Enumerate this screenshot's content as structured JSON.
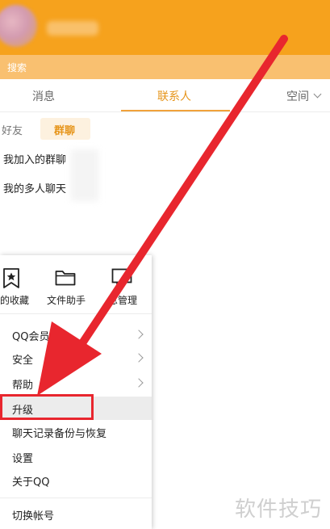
{
  "search": {
    "placeholder": "搜索"
  },
  "tabs": [
    {
      "label": "消息"
    },
    {
      "label": "联系人"
    },
    {
      "label": "空间"
    }
  ],
  "subtabs": {
    "friends": "好友",
    "groups": "群聊"
  },
  "groups_list": [
    {
      "label": "我加入的群聊"
    },
    {
      "label": "我的多人聊天"
    }
  ],
  "quick_actions": [
    {
      "label": "的收藏",
      "icon": "bookmark-star-icon"
    },
    {
      "label": "文件助手",
      "icon": "folder-icon"
    },
    {
      "label": "息管理",
      "icon": "message-manage-icon"
    }
  ],
  "menu": [
    {
      "label": "QQ会员",
      "has_submenu": true
    },
    {
      "label": "安全",
      "has_submenu": true
    },
    {
      "label": "帮助",
      "has_submenu": true
    },
    {
      "label": "升级",
      "highlighted": true
    },
    {
      "label": "聊天记录备份与恢复"
    },
    {
      "label": "设置"
    },
    {
      "label": "关于QQ"
    },
    {
      "label": "切换帐号"
    }
  ],
  "watermark": "软件技巧",
  "colors": {
    "header": "#f6a21d",
    "search_bar": "#f9c070",
    "active_tab": "#e6951b",
    "annotation_red": "#e8262e"
  }
}
